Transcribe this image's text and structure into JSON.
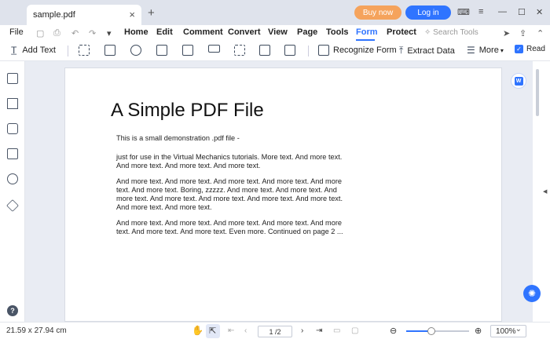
{
  "titlebar": {
    "tab_title": "sample.pdf",
    "tab_close": "×",
    "new_tab": "+",
    "buy_now": "Buy now",
    "log_in": "Log in",
    "controls": [
      "⌨",
      "≡",
      "—",
      "☐",
      "✕"
    ]
  },
  "menu": {
    "file": "File",
    "items": [
      "Home",
      "Edit",
      "Comment",
      "Convert",
      "View",
      "Page",
      "Tools",
      "Form",
      "Protect"
    ],
    "active": "Form",
    "search_tools": "Search Tools"
  },
  "toolbar": {
    "add_text": "Add Text",
    "recognize_form": "Recognize Form",
    "extract_data": "Extract Data",
    "more": "More",
    "read": "Read"
  },
  "document": {
    "title": "A Simple PDF File",
    "paragraphs": [
      "This is a small demonstration .pdf file -",
      "just for use in the Virtual Mechanics tutorials. More text. And more text. And more text. And more text. And more text.",
      "And more text. And more text. And more text. And more text. And more text. And more text. Boring, zzzzz. And more text. And more text. And more text. And more text. And more text. And more text. And more text. And more text. And more text.",
      "And more text. And more text. And more text. And more text. And more text. And more text. And more text. Even more. Continued on page 2 ..."
    ]
  },
  "status": {
    "dimensions": "21.59 x 27.94 cm",
    "page": "1 /2",
    "zoom": "100%",
    "zoom_fraction": 0.4
  },
  "colors": {
    "accent": "#2f74ff",
    "buy": "#f5a35c"
  }
}
